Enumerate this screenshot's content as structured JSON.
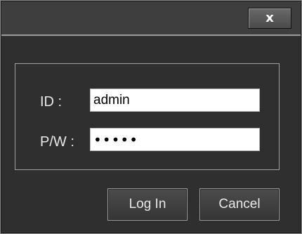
{
  "titlebar": {
    "close_glyph": "x",
    "close_icon": "close-icon"
  },
  "form": {
    "id_label": "ID :",
    "id_value": "admin",
    "password_label": "P/W :",
    "password_value": "•••••"
  },
  "buttons": {
    "login_label": "Log In",
    "cancel_label": "Cancel"
  },
  "colors": {
    "window_bg": "#2f2f2f",
    "titlebar_bg": "#3e3e3e",
    "label_text": "#e8e8e8",
    "input_bg": "#ffffff",
    "border": "#a0a0a0"
  }
}
